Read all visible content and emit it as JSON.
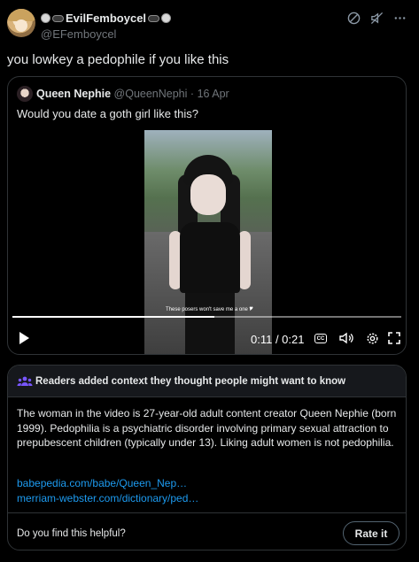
{
  "author": {
    "display_name": "EvilFemboycel",
    "handle": "@EFemboycel"
  },
  "post": {
    "text": "you lowkey a pedophile if you like this"
  },
  "quote": {
    "display_name": "Queen Nephie",
    "handle": "@QueenNephi",
    "date": "16 Apr",
    "text": "Would you date a goth girl like this?",
    "video": {
      "caption": "These posers won't save me a one 🎔",
      "time": "0:11 / 0:21",
      "progress": 0.52
    }
  },
  "community_note": {
    "title": "Readers added context they thought people might want to know",
    "body": "The woman in the video is 27-year-old adult content creator Queen Nephie (born 1999). Pedophilia is a psychiatric disorder involving primary sexual attraction to prepubescent children (typically under 13). Liking adult women is not pedophilia.",
    "links": [
      "babepedia.com/babe/Queen_Nep…",
      "merriam-webster.com/dictionary/ped…"
    ],
    "helpful_prompt": "Do you find this helpful?",
    "rate_label": "Rate it"
  },
  "icons": {
    "block": "block-icon",
    "mute": "mute-icon",
    "more": "more-icon",
    "accent": "#1d9bf0",
    "note_icon_color": "#7856ff"
  }
}
